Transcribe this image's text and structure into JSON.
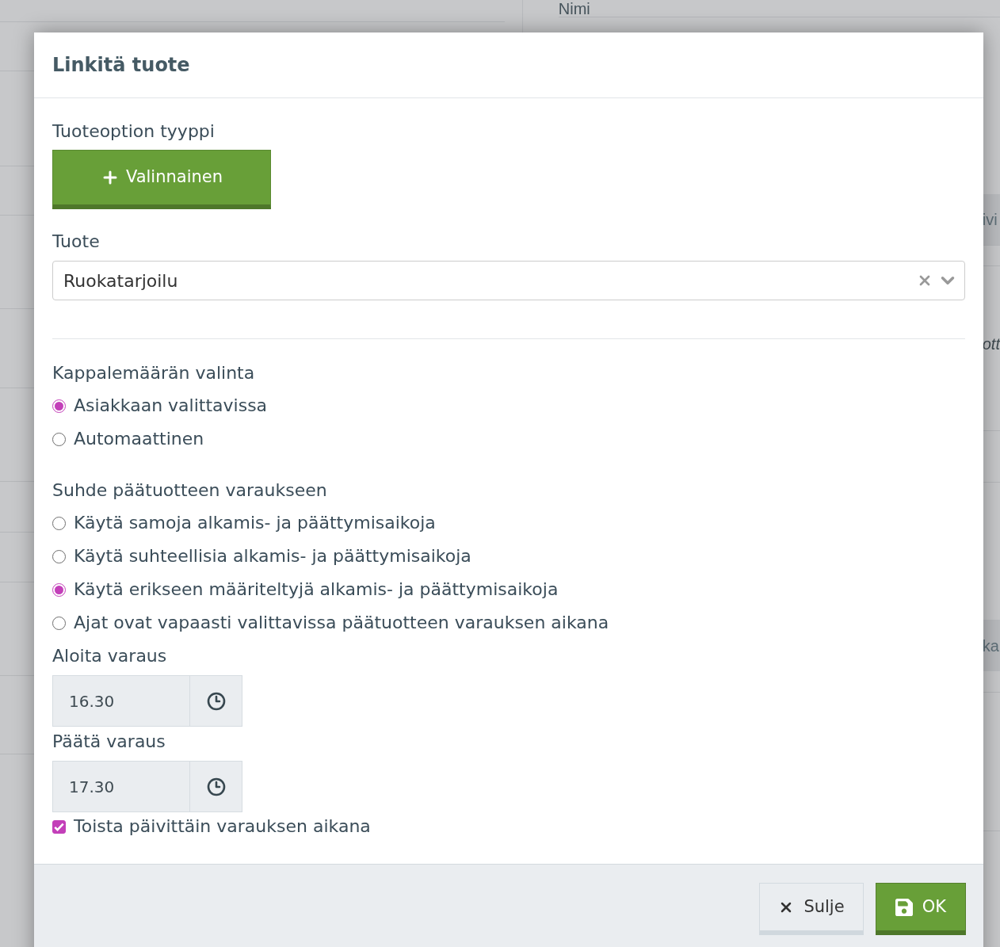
{
  "background": {
    "column_header": "Nimi",
    "fragments": [
      {
        "text": "ivi",
        "kind": "band"
      },
      {
        "text": "ott",
        "kind": "note"
      },
      {
        "text": "ka",
        "kind": "band"
      }
    ]
  },
  "dialog": {
    "title": "Linkitä tuote",
    "option_type": {
      "label": "Tuoteoption tyyppi",
      "button": "Valinnainen"
    },
    "product": {
      "label": "Tuote",
      "value": "Ruokatarjoilu"
    },
    "quantity": {
      "label": "Kappalemäärän valinta",
      "options": [
        {
          "label": "Asiakkaan valittavissa",
          "selected": true
        },
        {
          "label": "Automaattinen",
          "selected": false
        }
      ]
    },
    "relation": {
      "label": "Suhde päätuotteen varaukseen",
      "options": [
        {
          "label": "Käytä samoja alkamis- ja päättymisaikoja",
          "selected": false
        },
        {
          "label": "Käytä suhteellisia alkamis- ja päättymisaikoja",
          "selected": false
        },
        {
          "label": "Käytä erikseen määriteltyjä alkamis- ja päättymisaikoja",
          "selected": true
        },
        {
          "label": "Ajat ovat vapaasti valittavissa päätuotteen varauksen aikana",
          "selected": false
        }
      ]
    },
    "start": {
      "label": "Aloita varaus",
      "value": "16.30"
    },
    "end": {
      "label": "Päätä varaus",
      "value": "17.30"
    },
    "repeat": {
      "label": "Toista päivittäin varauksen aikana",
      "checked": true
    },
    "buttons": [
      {
        "label": "Sulje",
        "kind": "close"
      },
      {
        "label": "OK",
        "kind": "save"
      }
    ]
  }
}
